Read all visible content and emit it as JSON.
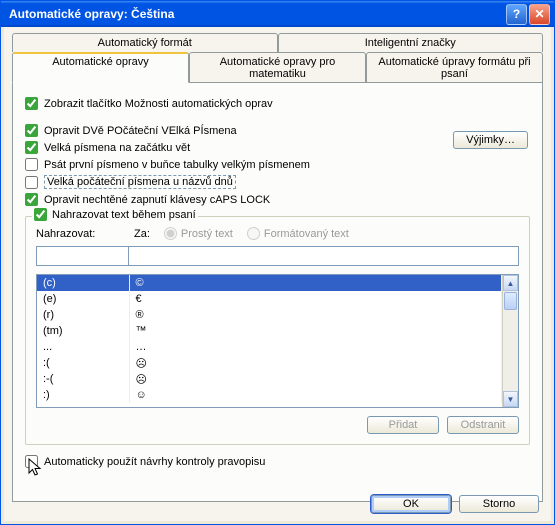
{
  "window": {
    "title": "Automatické opravy: Čeština"
  },
  "tabs_top": {
    "autoformat": "Automatický formát",
    "smarttags": "Inteligentní značky"
  },
  "tabs_bottom": {
    "autocorrect": "Automatické opravy",
    "math": "Automatické opravy pro matematiku",
    "asyoutype": "Automatické úpravy formátu při psaní"
  },
  "options": {
    "show_button": "Zobrazit tlačítko Možnosti automatických oprav",
    "two_caps": "Opravit DVě POčáteční VElká PÍsmena",
    "sentence": "Velká písmena na začátku vět",
    "table_cell": "Psát první písmeno v buňce tabulky velkým písmenem",
    "days": "Velká počáteční písmena u názvů dnů",
    "capslock": "Opravit nechtěné zapnutí klávesy cAPS LOCK",
    "exceptions": "Výjimky…"
  },
  "replace": {
    "legend": "Nahrazovat text během psaní",
    "replace_label": "Nahrazovat:",
    "with_label": "Za:",
    "plain": "Prostý text",
    "formatted": "Formátovaný text",
    "add": "Přidat",
    "delete": "Odstranit",
    "rows": [
      {
        "from": "(c)",
        "to": "©"
      },
      {
        "from": "(e)",
        "to": "€"
      },
      {
        "from": "(r)",
        "to": "®"
      },
      {
        "from": "(tm)",
        "to": "™"
      },
      {
        "from": "...",
        "to": "…"
      },
      {
        "from": ":(",
        "to": "☹"
      },
      {
        "from": ":-(",
        "to": "☹"
      },
      {
        "from": ":)",
        "to": "☺"
      }
    ]
  },
  "spelling": {
    "label": "Automaticky použít návrhy kontroly pravopisu"
  },
  "footer": {
    "ok": "OK",
    "cancel": "Storno"
  }
}
